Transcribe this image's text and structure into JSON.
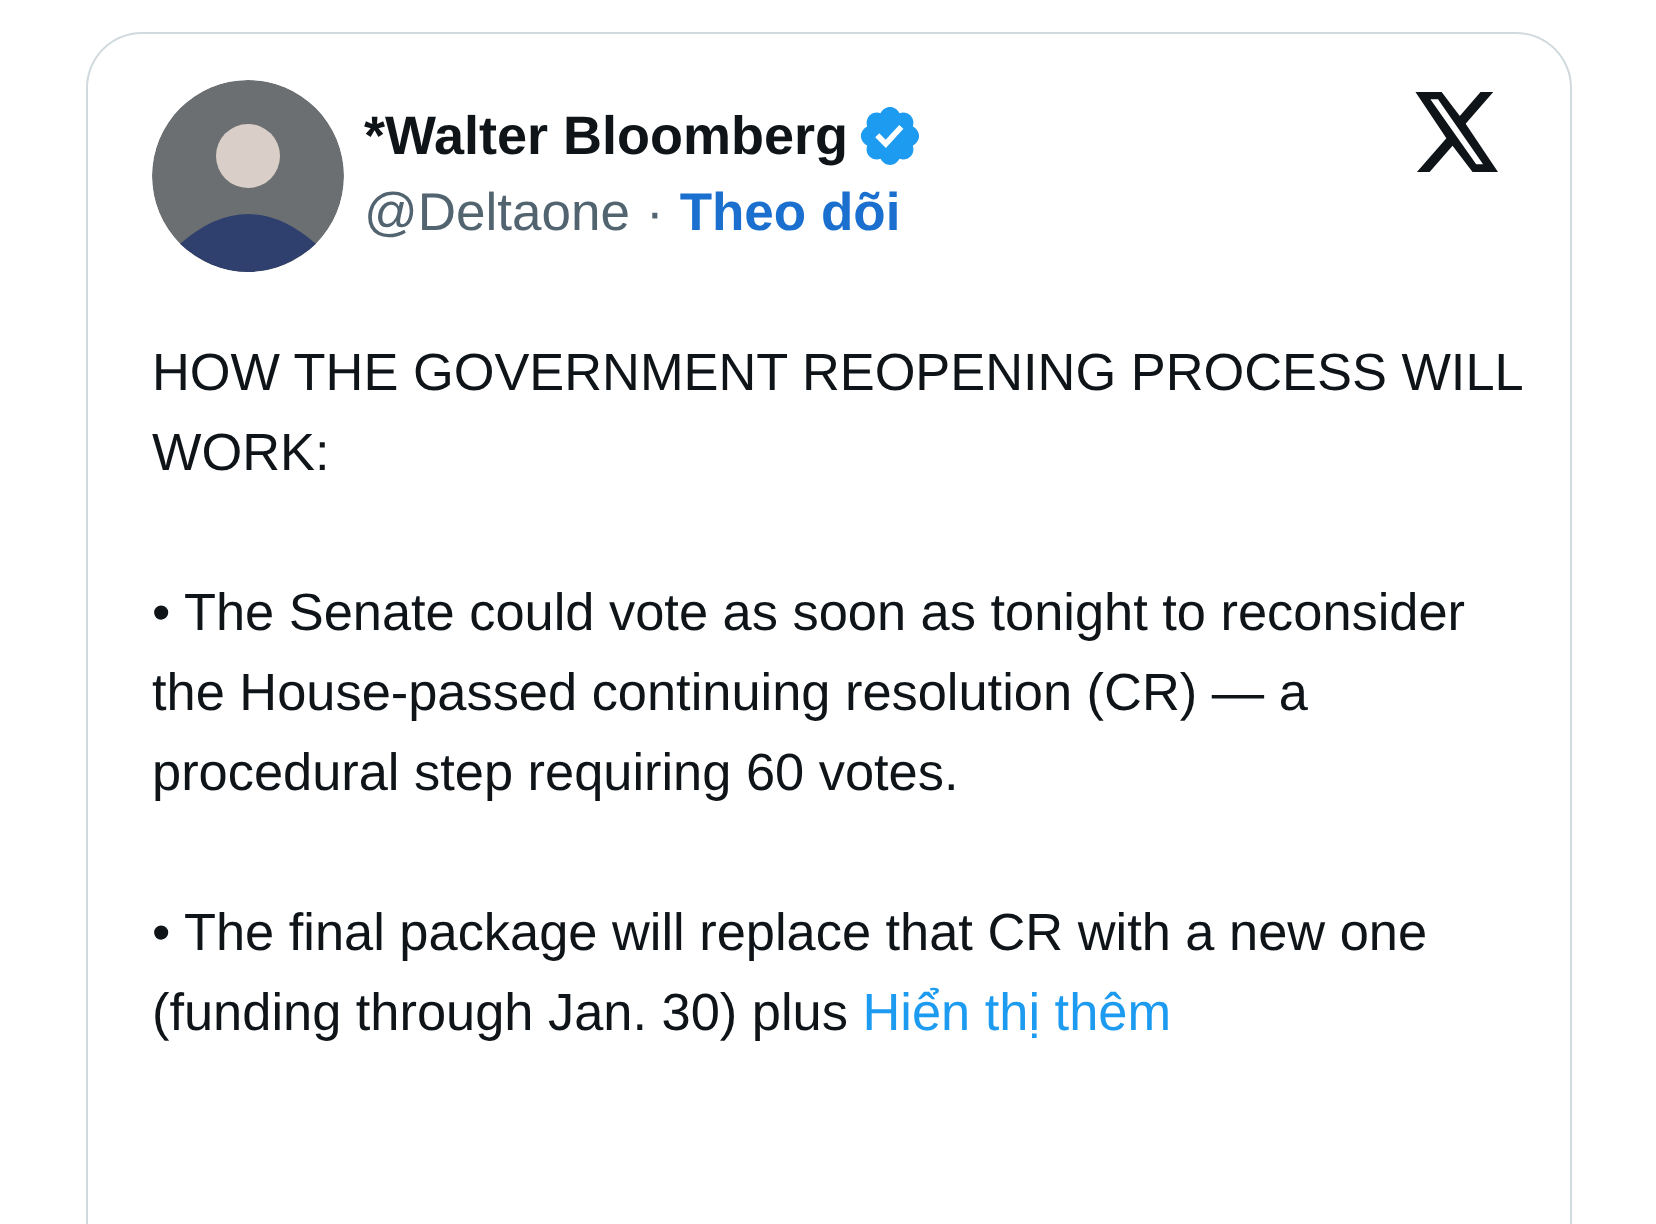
{
  "author": {
    "name": "*Walter Bloomberg",
    "verified": true,
    "handle": "@Deltaone",
    "separator": "·",
    "follow": "Theo dõi"
  },
  "body": {
    "paragraphs": [
      "HOW THE GOVERNMENT REOPENING PROCESS WILL WORK:",
      "• The Senate could vote as soon as tonight to reconsider the House-passed continuing resolution (CR) — a procedural step requiring 60 votes.",
      "• The final package will replace that CR with a new one (funding through Jan. 30) plus"
    ],
    "more_link": "Hiển thị thêm"
  }
}
